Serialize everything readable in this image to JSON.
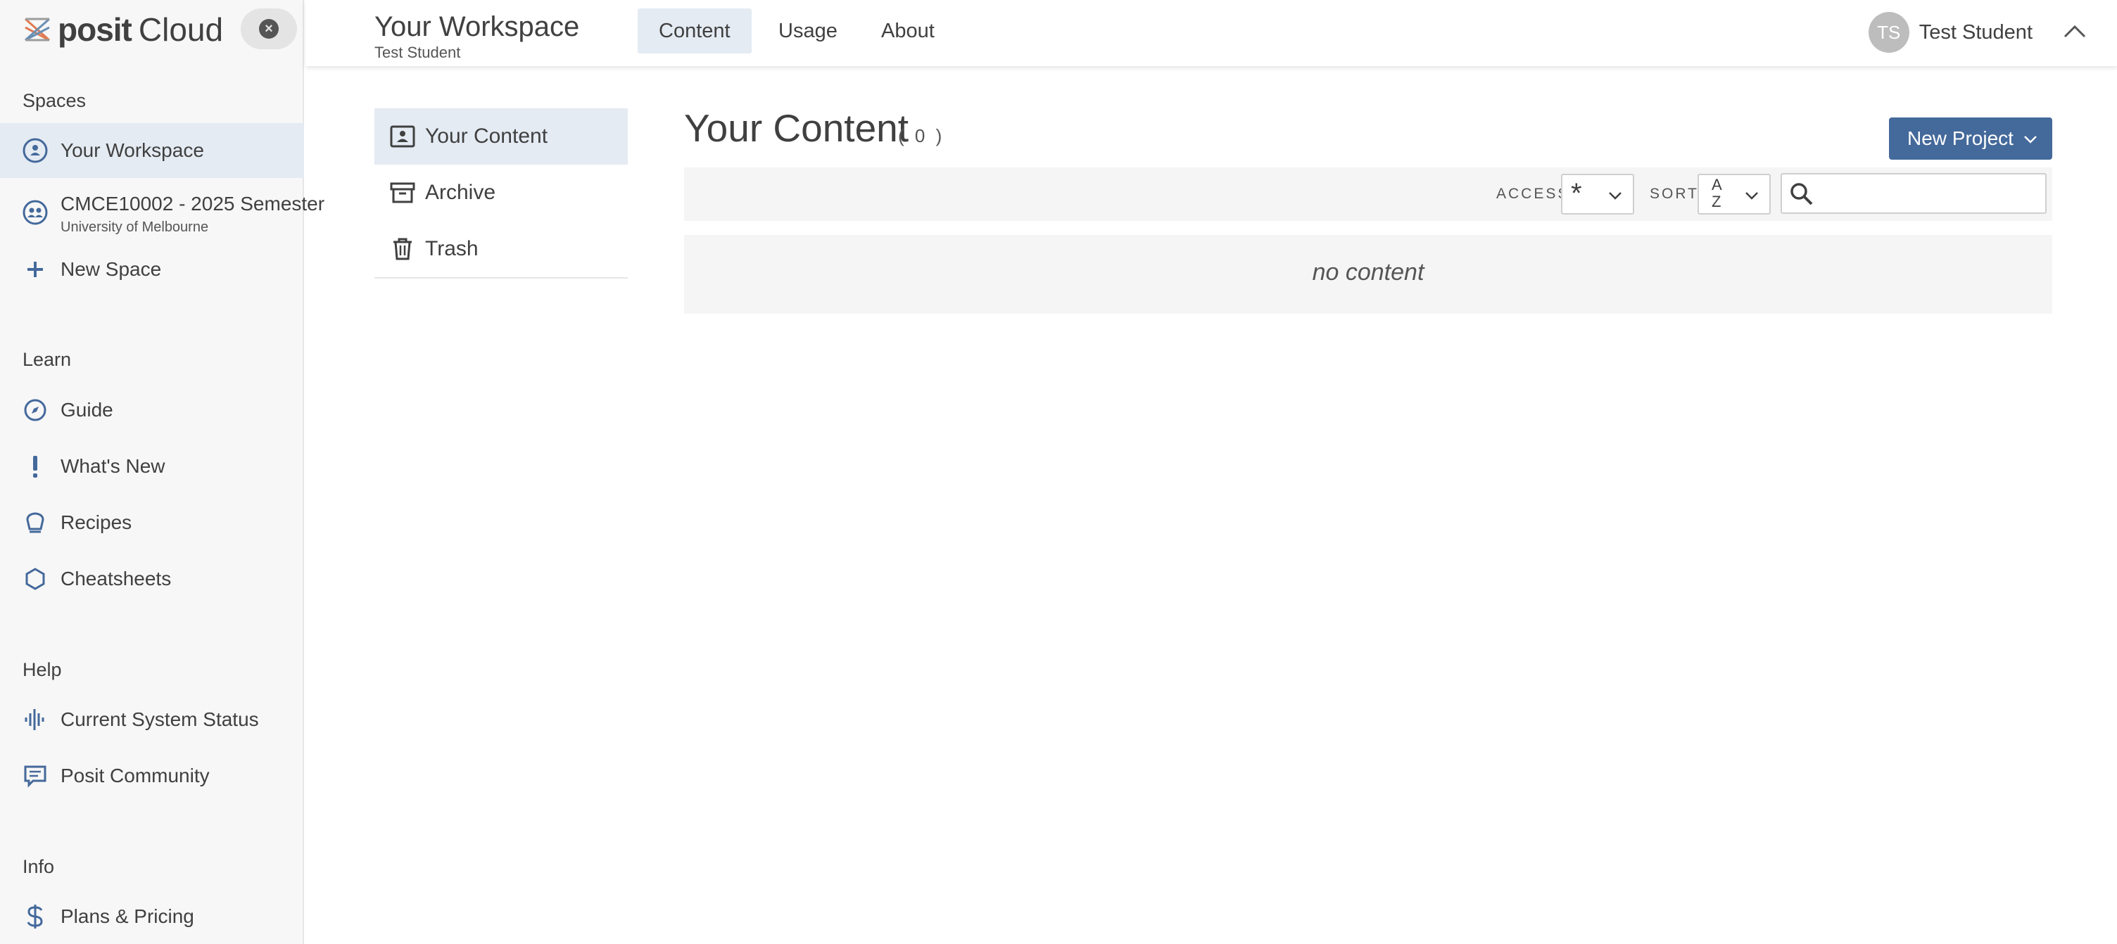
{
  "app": {
    "logo_posit": "posit",
    "logo_cloud": "Cloud",
    "accent_color": "#44699b"
  },
  "sidebar": {
    "close_icon": "close-icon",
    "sections": {
      "spaces": "Spaces",
      "learn": "Learn",
      "help": "Help",
      "info": "Info"
    },
    "spaces": [
      {
        "label": "Your Workspace",
        "icon": "person-circle-icon",
        "active": true
      },
      {
        "label": "CMCE10002 - 2025 Semester",
        "sublabel": "University of Melbourne",
        "icon": "group-icon"
      },
      {
        "label": "New Space",
        "icon": "plus-icon"
      }
    ],
    "learn": [
      {
        "label": "Guide",
        "icon": "compass-icon"
      },
      {
        "label": "What's New",
        "icon": "exclamation-icon"
      },
      {
        "label": "Recipes",
        "icon": "chef-hat-icon"
      },
      {
        "label": "Cheatsheets",
        "icon": "hexagon-icon"
      }
    ],
    "help": [
      {
        "label": "Current System Status",
        "icon": "pulse-icon"
      },
      {
        "label": "Posit Community",
        "icon": "chat-icon"
      }
    ],
    "info": [
      {
        "label": "Plans & Pricing",
        "icon": "dollar-icon"
      }
    ]
  },
  "header": {
    "title": "Your Workspace",
    "subtitle": "Test Student",
    "tabs": [
      {
        "label": "Content",
        "active": true
      },
      {
        "label": "Usage"
      },
      {
        "label": "About"
      }
    ],
    "user": {
      "initials": "TS",
      "name": "Test Student"
    }
  },
  "content_nav": [
    {
      "label": "Your Content",
      "icon": "person-badge-icon",
      "active": true
    },
    {
      "label": "Archive",
      "icon": "archive-box-icon"
    },
    {
      "label": "Trash",
      "icon": "trash-icon"
    }
  ],
  "main": {
    "title": "Your Content",
    "count": "( 0 )",
    "new_project_label": "New Project",
    "access_label": "ACCESS",
    "access_value": "*",
    "sort_label": "SORT",
    "sort_value_top": "A",
    "sort_value_bottom": "Z",
    "search_placeholder": "",
    "empty_text": "no content"
  }
}
